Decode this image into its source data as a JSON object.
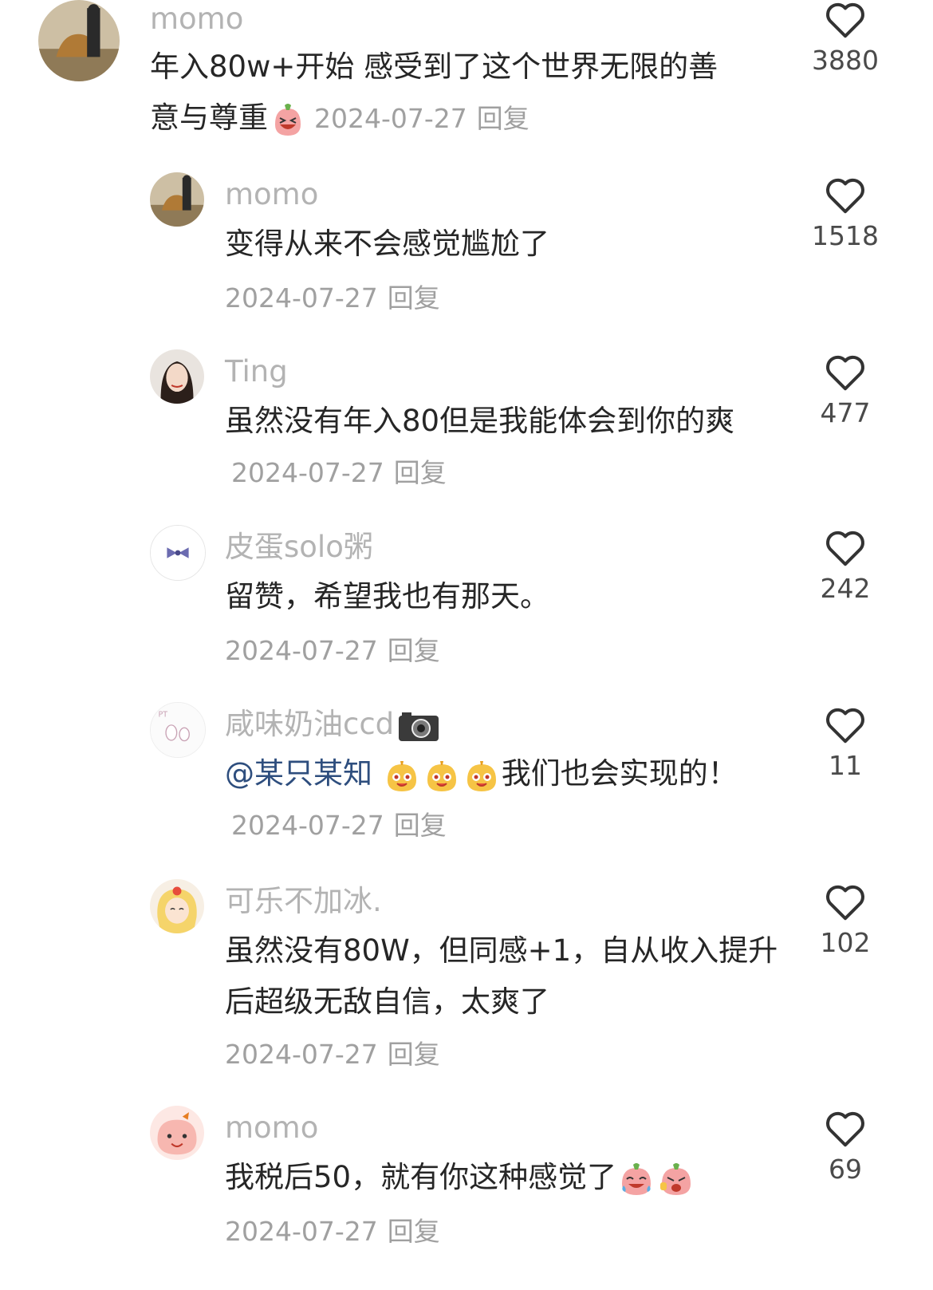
{
  "comments": [
    {
      "name": "momo",
      "text": "年入80w+开始 感受到了这个世界无限的善意与尊重",
      "date": "2024-07-27",
      "reply": "回复",
      "likes": "3880"
    },
    {
      "name": "momo",
      "text": "变得从来不会感觉尴尬了",
      "date": "2024-07-27",
      "reply": "回复",
      "likes": "1518"
    },
    {
      "name": "Ting",
      "text": "虽然没有年入80但是我能体会到你的爽",
      "date": "2024-07-27",
      "reply": "回复",
      "likes": "477"
    },
    {
      "name": "皮蛋solo粥",
      "text": "留赞，希望我也有那天。",
      "date": "2024-07-27",
      "reply": "回复",
      "likes": "242"
    },
    {
      "name": "咸味奶油ccd",
      "mention": "@某只某知",
      "text": "我们也会实现的！",
      "date": "2024-07-27",
      "reply": "回复",
      "likes": "11"
    },
    {
      "name": "可乐不加冰.",
      "text": "虽然没有80W，但同感+1，自从收入提升后超级无敌自信，太爽了",
      "date": "2024-07-27",
      "reply": "回复",
      "likes": "102"
    },
    {
      "name": "momo",
      "text": "我税后50，就有你这种感觉了",
      "date": "2024-07-27",
      "reply": "回复",
      "likes": "69"
    }
  ],
  "icons": {
    "like": "heart-outline-icon"
  }
}
